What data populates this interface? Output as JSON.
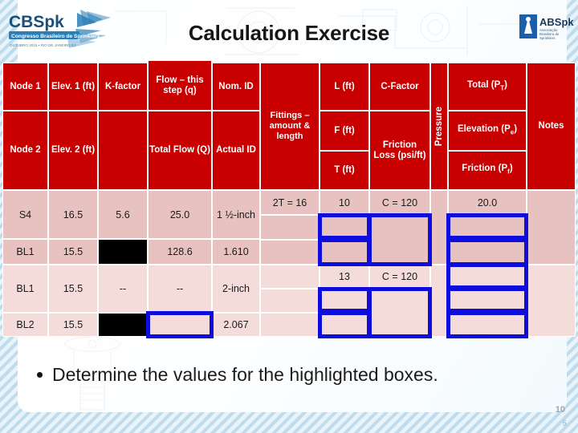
{
  "slide": {
    "title": "Calculation Exercise",
    "number": "10",
    "number_secondary": "5",
    "bullet": "Determine the values for the highlighted boxes.",
    "accent_red": "#c80000",
    "highlight_blue": "#0d0ddd",
    "row_shade_a": "#e8c2c0",
    "row_shade_b": "#f4dcda"
  },
  "logos": {
    "left": {
      "name": "cbspk-logo",
      "wordmark": "CBSpk",
      "tagline": "Congresso Brasileiro de Sprinklers",
      "subtagline": "OUTUBRO 2015 • RIO DE JANEIRO RJ"
    },
    "right": {
      "name": "abspk-logo",
      "wordmark": "ABSpk",
      "tagline": "Associação Brasileira de Sprinklers"
    }
  },
  "table": {
    "headers_row1": [
      "Node 1",
      "Elev. 1 (ft)",
      "K-factor",
      "Flow – this step (q)",
      "Nom. ID",
      "Fittings – amount & length",
      "L (ft)",
      "C-Factor",
      "Pressure",
      "Total (P_T)",
      "Notes"
    ],
    "headers_row2": [
      "Node 2",
      "Elev. 2 (ft)",
      "",
      "Total Flow (Q)",
      "Actual ID",
      "F (ft)",
      "T (ft)",
      "Friction Loss (psi/ft)",
      "Elevation (P_e)",
      "Friction (P_f)"
    ],
    "header_cells": {
      "node1": "Node 1",
      "node2": "Node 2",
      "elev1": "Elev. 1 (ft)",
      "elev2": "Elev. 2 (ft)",
      "kfactor": "K-factor",
      "flow_step": "Flow – this step (q)",
      "total_flow": "Total Flow (Q)",
      "nom_id": "Nom. ID",
      "actual_id": "Actual ID",
      "fittings": "Fittings – amount & length",
      "l_ft": "L (ft)",
      "f_ft": "F (ft)",
      "t_ft": "T (ft)",
      "c_factor": "C-Factor",
      "friction_loss": "Friction Loss (psi/ft)",
      "pressure": "Pressure",
      "total_pt": "Total (P",
      "total_pt_sub": "T",
      "total_pt_end": ")",
      "elevation_pe": "Elevation (P",
      "elevation_pe_sub": "e",
      "elevation_pe_end": ")",
      "friction_pf": "Friction (P",
      "friction_pf_sub": "f",
      "friction_pf_end": ")",
      "notes": "Notes"
    },
    "rows": [
      {
        "group": 1,
        "node1": "S4",
        "node2": "BL1",
        "elev1": "16.5",
        "elev2": "15.5",
        "kfactor": "5.6",
        "kfactor2": "",
        "flow_step": "25.0",
        "total_flow": "128.6",
        "nom_id": "1 ½-inch",
        "actual_id": "1.610",
        "fittings": "2T = 16",
        "fittings2": "",
        "l_ft": "10",
        "f_ft": "",
        "t_ft": "",
        "c_factor": "C = 120",
        "friction_loss": "",
        "total_pt": "20.0",
        "elevation_pe": "",
        "friction_pf": "",
        "notes": ""
      },
      {
        "group": 2,
        "node1": "BL1",
        "node2": "BL2",
        "elev1": "15.5",
        "elev2": "15.5",
        "kfactor": "--",
        "kfactor2": "",
        "flow_step": "--",
        "total_flow": "",
        "nom_id": "2-inch",
        "actual_id": "2.067",
        "fittings": "",
        "fittings2": "",
        "l_ft": "13",
        "f_ft": "",
        "t_ft": "",
        "c_factor": "C = 120",
        "friction_loss": "",
        "total_pt": "",
        "elevation_pe": "",
        "friction_pf": "",
        "notes": ""
      }
    ]
  }
}
